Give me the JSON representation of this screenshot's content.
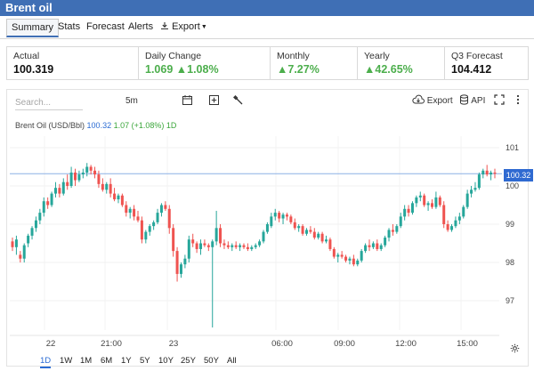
{
  "title": "Brent oil",
  "tabs": [
    {
      "label": "Summary",
      "active": true
    },
    {
      "label": "Stats"
    },
    {
      "label": "Forecast"
    },
    {
      "label": "Alerts"
    },
    {
      "label": "Export"
    }
  ],
  "stats": [
    {
      "label": "Actual",
      "value": "100.319"
    },
    {
      "label": "Daily Change",
      "value": "1.069 ▲1.08%"
    },
    {
      "label": "Monthly",
      "value": "▲7.27%"
    },
    {
      "label": "Yearly",
      "value": "▲42.65%"
    },
    {
      "label": "Q3 Forecast",
      "value": "104.412"
    }
  ],
  "toolbar": {
    "search_placeholder": "Search...",
    "interval": "5m",
    "export_label": "Export",
    "api_label": "API"
  },
  "legend": {
    "symbol": "Brent Oil (USD/Bbl)",
    "price": "100.32",
    "change": "1.07 (+1.08%)",
    "period": "1D"
  },
  "price_tag": "100.32",
  "periods": [
    "1D",
    "1W",
    "1M",
    "6M",
    "1Y",
    "5Y",
    "10Y",
    "25Y",
    "50Y",
    "All"
  ],
  "active_period": "1D",
  "colors": {
    "up": "#26a69a",
    "down": "#ef5350",
    "accent": "#2f6ad1",
    "header": "#3f6fb5"
  },
  "chart_data": {
    "type": "candlestick",
    "y_ticks": [
      "101",
      "100",
      "99",
      "98",
      "97"
    ],
    "x_ticks": [
      "22",
      "21:00",
      "23",
      "06:00",
      "09:00",
      "12:00",
      "15:00"
    ],
    "last_price": 100.32,
    "ylim": [
      96.3,
      101.2
    ],
    "x_index_range": [
      0,
      218
    ],
    "x_tick_positions": [
      15,
      46,
      72,
      117,
      145,
      173,
      201
    ],
    "candles": [
      [
        0,
        98.55,
        98.65,
        98.3,
        98.4
      ],
      [
        1,
        98.4,
        98.7,
        98.2,
        98.6
      ],
      [
        2,
        98.2,
        98.3,
        98.0,
        98.1
      ],
      [
        3,
        98.1,
        98.5,
        98.0,
        98.45
      ],
      [
        4,
        98.5,
        98.75,
        98.4,
        98.7
      ],
      [
        5,
        98.7,
        98.95,
        98.6,
        98.9
      ],
      [
        6,
        98.9,
        99.2,
        98.8,
        99.1
      ],
      [
        7,
        99.1,
        99.4,
        99.0,
        99.3
      ],
      [
        8,
        99.3,
        99.7,
        99.2,
        99.6
      ],
      [
        9,
        99.6,
        99.7,
        99.4,
        99.5
      ],
      [
        10,
        99.5,
        99.85,
        99.45,
        99.8
      ],
      [
        11,
        99.8,
        100.1,
        99.7,
        99.95
      ],
      [
        12,
        99.95,
        100.05,
        99.7,
        99.8
      ],
      [
        13,
        99.8,
        100.2,
        99.75,
        100.1
      ],
      [
        14,
        100.1,
        100.3,
        99.9,
        100.0
      ],
      [
        15,
        100.0,
        100.5,
        99.95,
        100.35
      ],
      [
        16,
        100.35,
        100.45,
        100.0,
        100.15
      ],
      [
        17,
        100.15,
        100.4,
        100.1,
        100.3
      ],
      [
        18,
        100.3,
        100.45,
        100.2,
        100.35
      ],
      [
        19,
        100.35,
        100.6,
        100.25,
        100.5
      ],
      [
        20,
        100.5,
        100.55,
        100.3,
        100.4
      ],
      [
        21,
        100.4,
        100.5,
        100.2,
        100.3
      ],
      [
        22,
        100.3,
        100.4,
        99.95,
        100.05
      ],
      [
        23,
        100.05,
        100.2,
        99.85,
        99.9
      ],
      [
        24,
        99.9,
        100.1,
        99.8,
        100.05
      ],
      [
        25,
        100.05,
        100.2,
        99.7,
        99.8
      ],
      [
        26,
        99.8,
        99.95,
        99.6,
        99.65
      ],
      [
        27,
        99.65,
        99.8,
        99.55,
        99.75
      ],
      [
        28,
        99.75,
        99.8,
        99.45,
        99.5
      ],
      [
        29,
        99.5,
        99.6,
        99.2,
        99.3
      ],
      [
        30,
        99.3,
        99.45,
        99.15,
        99.4
      ],
      [
        31,
        99.4,
        99.5,
        99.1,
        99.2
      ],
      [
        32,
        99.2,
        99.35,
        99.05,
        99.1
      ],
      [
        33,
        99.1,
        99.2,
        98.5,
        98.6
      ],
      [
        34,
        98.6,
        98.85,
        98.5,
        98.8
      ],
      [
        35,
        98.8,
        99.0,
        98.7,
        98.95
      ],
      [
        36,
        98.95,
        99.1,
        98.85,
        99.05
      ],
      [
        37,
        99.05,
        99.4,
        99.0,
        99.3
      ],
      [
        38,
        99.3,
        99.55,
        99.2,
        99.5
      ],
      [
        39,
        99.5,
        99.6,
        99.35,
        99.4
      ],
      [
        40,
        99.4,
        99.5,
        98.75,
        98.9
      ],
      [
        41,
        98.9,
        99.0,
        98.15,
        98.3
      ],
      [
        42,
        98.3,
        98.4,
        97.5,
        97.7
      ],
      [
        43,
        97.7,
        98.0,
        97.6,
        97.95
      ],
      [
        44,
        97.95,
        98.2,
        97.85,
        98.1
      ],
      [
        45,
        98.1,
        98.7,
        98.0,
        98.6
      ],
      [
        46,
        98.6,
        98.75,
        98.4,
        98.5
      ],
      [
        47,
        98.5,
        98.55,
        98.25,
        98.35
      ],
      [
        48,
        98.35,
        98.6,
        98.2,
        98.5
      ],
      [
        49,
        98.5,
        98.6,
        98.4,
        98.45
      ],
      [
        50,
        98.45,
        98.5,
        98.3,
        98.4
      ],
      [
        51,
        98.4,
        98.6,
        96.3,
        98.55
      ],
      [
        52,
        98.55,
        99.35,
        98.45,
        98.9
      ],
      [
        53,
        98.9,
        99.0,
        98.4,
        98.5
      ],
      [
        54,
        98.5,
        98.6,
        98.35,
        98.45
      ],
      [
        55,
        98.45,
        98.55,
        98.35,
        98.4
      ],
      [
        56,
        98.4,
        98.5,
        98.3,
        98.45
      ],
      [
        57,
        98.45,
        98.55,
        98.35,
        98.4
      ],
      [
        58,
        98.4,
        98.5,
        98.3,
        98.45
      ],
      [
        59,
        98.45,
        98.5,
        98.35,
        98.4
      ],
      [
        60,
        98.4,
        98.5,
        98.3,
        98.35
      ],
      [
        61,
        98.35,
        98.45,
        98.3,
        98.4
      ],
      [
        62,
        98.4,
        98.5,
        98.35,
        98.45
      ],
      [
        63,
        98.45,
        98.6,
        98.4,
        98.55
      ],
      [
        64,
        98.55,
        98.85,
        98.5,
        98.8
      ],
      [
        65,
        98.8,
        99.05,
        98.75,
        99.0
      ],
      [
        66,
        98.95,
        99.3,
        98.9,
        99.2
      ],
      [
        67,
        99.2,
        99.4,
        99.1,
        99.3
      ],
      [
        68,
        99.3,
        99.35,
        99.05,
        99.15
      ],
      [
        69,
        99.15,
        99.3,
        99.0,
        99.25
      ],
      [
        70,
        99.25,
        99.3,
        99.1,
        99.2
      ],
      [
        71,
        99.2,
        99.25,
        99.0,
        99.05
      ],
      [
        72,
        99.05,
        99.15,
        98.85,
        98.9
      ],
      [
        73,
        98.9,
        99.0,
        98.8,
        98.95
      ],
      [
        74,
        98.95,
        99.0,
        98.7,
        98.75
      ],
      [
        75,
        98.75,
        98.9,
        98.7,
        98.85
      ],
      [
        76,
        98.85,
        98.95,
        98.75,
        98.8
      ],
      [
        77,
        98.8,
        98.9,
        98.6,
        98.65
      ],
      [
        78,
        98.65,
        98.8,
        98.6,
        98.75
      ],
      [
        79,
        98.75,
        98.8,
        98.5,
        98.55
      ],
      [
        80,
        98.55,
        98.7,
        98.5,
        98.6
      ],
      [
        81,
        98.6,
        98.65,
        98.3,
        98.35
      ],
      [
        82,
        98.35,
        98.4,
        98.1,
        98.15
      ],
      [
        83,
        98.15,
        98.25,
        98.0,
        98.2
      ],
      [
        84,
        98.2,
        98.3,
        98.1,
        98.15
      ],
      [
        85,
        98.15,
        98.2,
        98.0,
        98.05
      ],
      [
        86,
        98.05,
        98.15,
        97.95,
        98.1
      ],
      [
        87,
        98.1,
        98.2,
        97.9,
        97.95
      ],
      [
        88,
        97.95,
        98.1,
        97.9,
        98.05
      ],
      [
        89,
        98.05,
        98.35,
        98.0,
        98.3
      ],
      [
        90,
        98.3,
        98.5,
        98.25,
        98.45
      ],
      [
        91,
        98.45,
        98.6,
        98.3,
        98.4
      ],
      [
        92,
        98.4,
        98.55,
        98.35,
        98.5
      ],
      [
        93,
        98.5,
        98.6,
        98.3,
        98.35
      ],
      [
        94,
        98.35,
        98.5,
        98.3,
        98.45
      ],
      [
        95,
        98.45,
        98.7,
        98.4,
        98.65
      ],
      [
        96,
        98.65,
        98.9,
        98.55,
        98.85
      ],
      [
        97,
        98.85,
        99.0,
        98.7,
        98.8
      ],
      [
        98,
        98.8,
        99.0,
        98.75,
        98.95
      ],
      [
        99,
        98.95,
        99.3,
        98.9,
        99.2
      ],
      [
        100,
        99.2,
        99.5,
        99.1,
        99.4
      ],
      [
        101,
        99.4,
        99.5,
        99.2,
        99.3
      ],
      [
        102,
        99.3,
        99.6,
        99.25,
        99.55
      ],
      [
        103,
        99.55,
        99.75,
        99.45,
        99.7
      ],
      [
        104,
        99.7,
        99.85,
        99.6,
        99.75
      ],
      [
        105,
        99.75,
        99.8,
        99.45,
        99.5
      ],
      [
        106,
        99.5,
        99.6,
        99.35,
        99.55
      ],
      [
        107,
        99.55,
        99.65,
        99.4,
        99.45
      ],
      [
        108,
        99.45,
        99.85,
        99.4,
        99.7
      ],
      [
        109,
        99.7,
        99.75,
        99.45,
        99.5
      ],
      [
        110,
        99.5,
        99.6,
        98.9,
        99.0
      ],
      [
        111,
        99.0,
        99.1,
        98.8,
        98.85
      ],
      [
        112,
        98.85,
        99.0,
        98.8,
        98.95
      ],
      [
        113,
        98.95,
        99.2,
        98.9,
        99.1
      ],
      [
        114,
        99.1,
        99.3,
        99.0,
        99.2
      ],
      [
        115,
        99.2,
        99.5,
        99.15,
        99.45
      ],
      [
        116,
        99.45,
        99.9,
        99.4,
        99.8
      ],
      [
        117,
        99.8,
        100.0,
        99.7,
        99.9
      ],
      [
        118,
        99.9,
        100.1,
        99.85,
        99.95
      ],
      [
        119,
        99.95,
        100.35,
        99.9,
        100.3
      ],
      [
        120,
        100.3,
        100.45,
        100.2,
        100.4
      ],
      [
        121,
        100.4,
        100.55,
        100.25,
        100.3
      ],
      [
        122,
        100.3,
        100.4,
        100.15,
        100.35
      ],
      [
        123,
        100.35,
        100.45,
        100.2,
        100.32
      ]
    ]
  }
}
